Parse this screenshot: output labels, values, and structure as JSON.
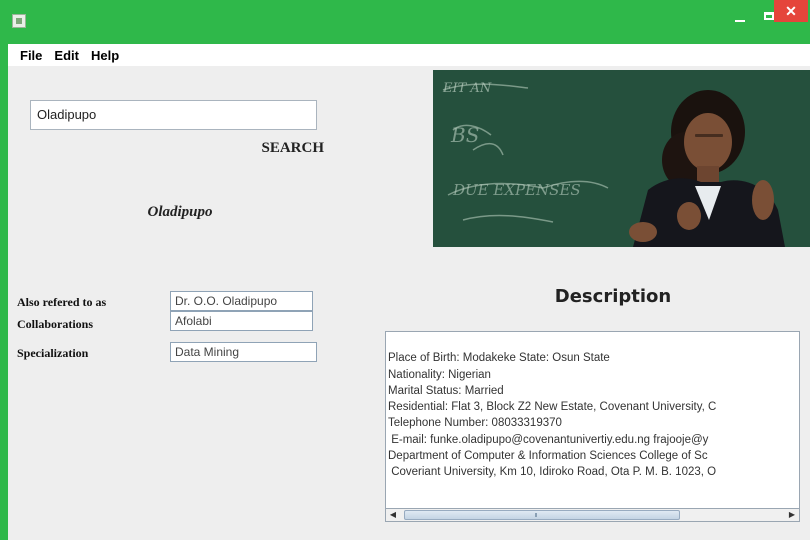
{
  "window": {
    "title": "",
    "controls": {
      "minimize": "–",
      "maximize": "□",
      "close": "✕"
    },
    "colors": {
      "titlebar": "#2fb84a",
      "close": "#e5453b"
    }
  },
  "menu": {
    "items": [
      {
        "label": "File"
      },
      {
        "label": "Edit"
      },
      {
        "label": "Help"
      }
    ]
  },
  "search": {
    "value": "Oladipupo",
    "button_label": "SEARCH"
  },
  "result": {
    "name": "Oladipupo"
  },
  "fields": [
    {
      "label": "Also refered to as",
      "value": "Dr. O.O. Oladipupo"
    },
    {
      "label": "Collaborations",
      "value": "Afolabi"
    },
    {
      "label": "Specialization",
      "value": "Data Mining"
    }
  ],
  "photo": {
    "icon": "portrait-photo",
    "chalk_words": [
      "EIT AN",
      "BS",
      "DUE EXPENSES"
    ]
  },
  "description": {
    "title": "Description",
    "lines": [
      "Place of Birth: Modakeke State: Osun State",
      "Nationality: Nigerian",
      "Marital Status: Married",
      "Residential: Flat 3, Block Z2 New Estate, Covenant University, C",
      "Telephone Number: 08033319370",
      " E-mail: funke.oladipupo@covenantunivertiy.edu.ng frajooje@y",
      "Department of Computer & Information Sciences College of Sc",
      " Coveriant University, Km 10, Idiroko Road, Ota P. M. B. 1023, O"
    ]
  },
  "scrollbar": {
    "left_arrow": "◀",
    "right_arrow": "▶"
  }
}
